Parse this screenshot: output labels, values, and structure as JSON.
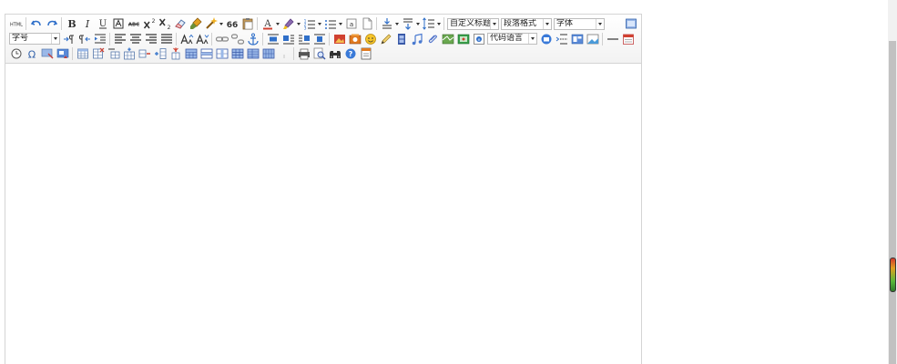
{
  "toolbar": {
    "row1": {
      "source_label": "HTML",
      "bold_label": "B",
      "italic_label": "I",
      "underline_label": "U",
      "strikethrough_label": "ABC",
      "blockquote_label": "66",
      "forecolor_label": "A",
      "custom_title_combo": "自定义标题",
      "paragraph_combo": "段落格式",
      "font_family_combo": "字体"
    },
    "row2": {
      "font_size_combo": "字号",
      "code_language_combo": "代码语言"
    }
  },
  "colors": {
    "toolbar_bg": "#f2f2f2",
    "border": "#d4d4d4",
    "icon_blue": "#2f6fc9",
    "icon_dark": "#333333",
    "icon_red": "#d04030"
  }
}
